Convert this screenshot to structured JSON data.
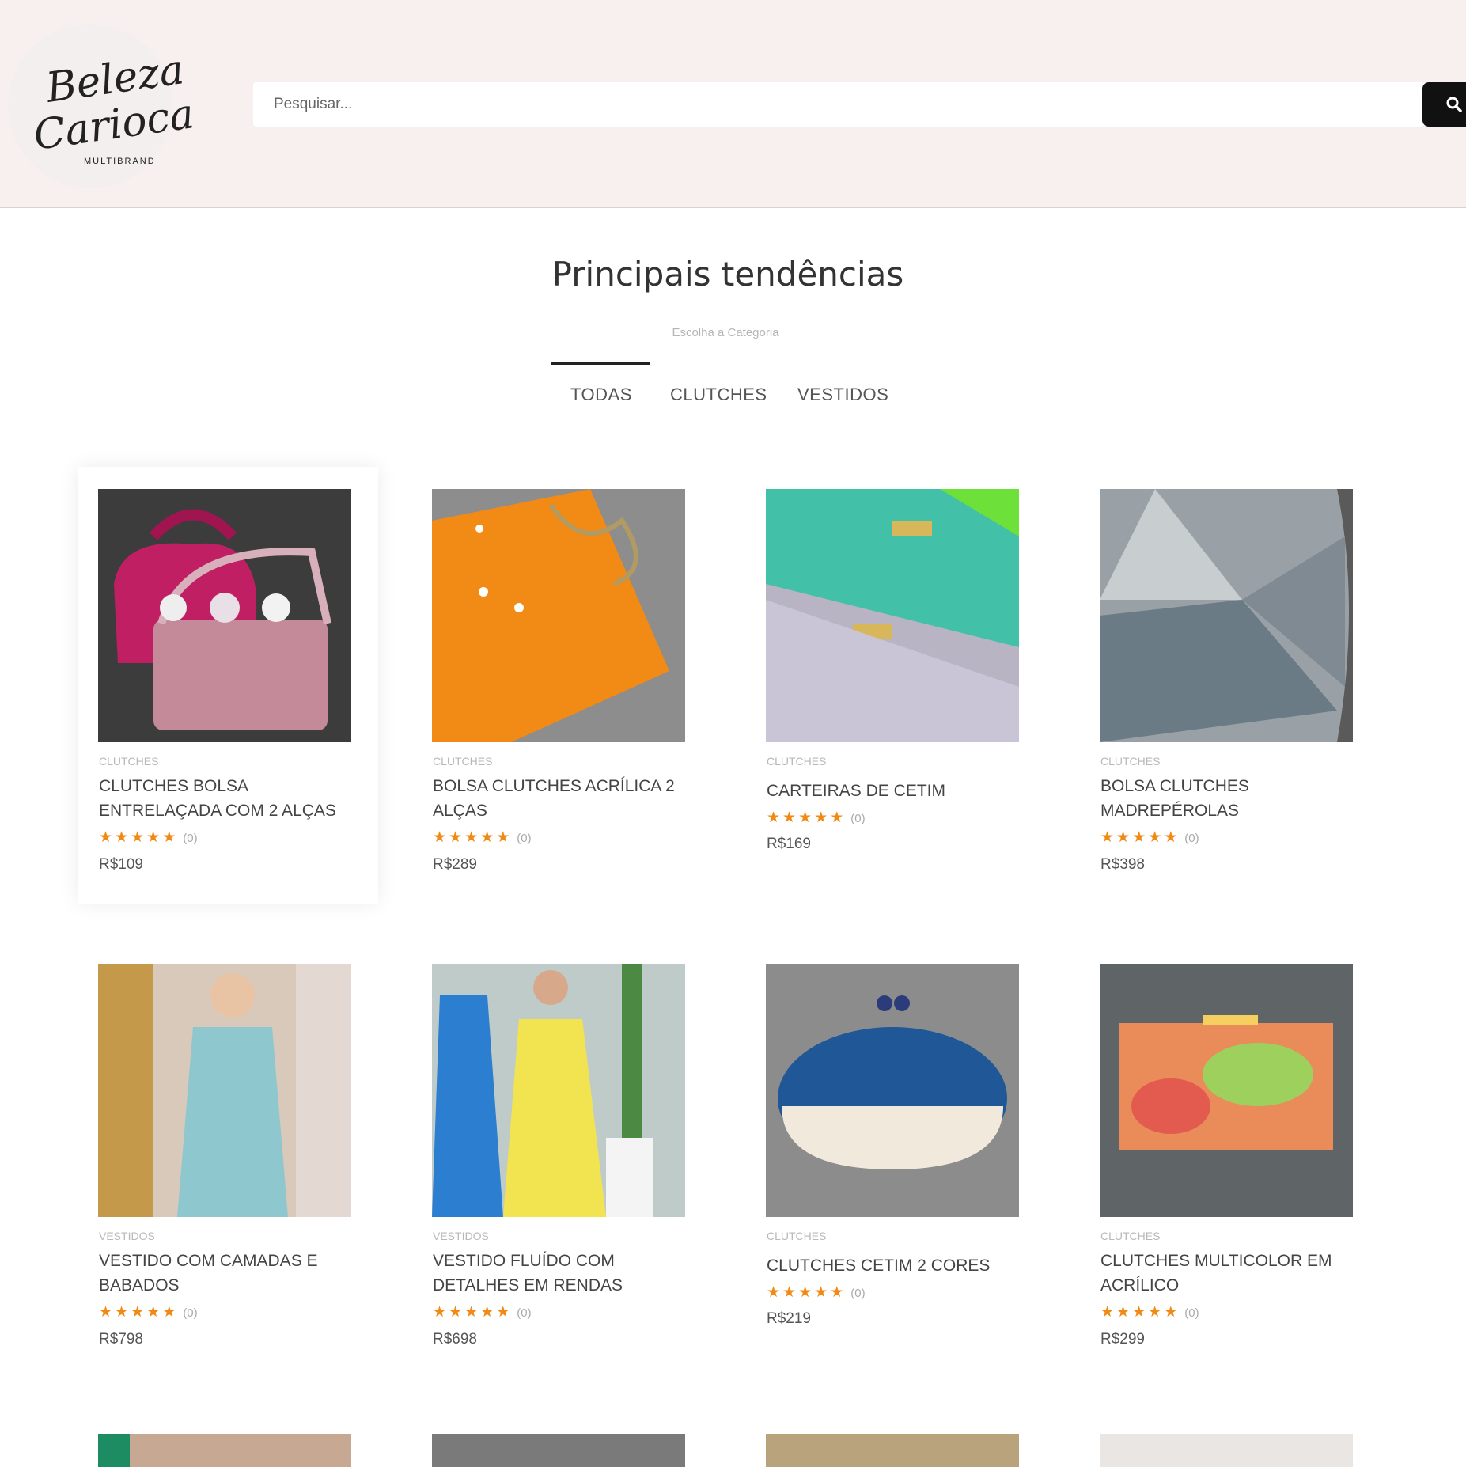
{
  "header": {
    "logo_line1": "Beleza",
    "logo_line2": "Carioca",
    "logo_sub": "MULTIBRAND",
    "search_placeholder": "Pesquisar...",
    "search_icon": "search-icon"
  },
  "section": {
    "title": "Principais tendências",
    "subtitle": "Escolha a Categoria",
    "tabs": [
      "TODAS",
      "CLUTCHES",
      "VESTIDOS"
    ],
    "active_tab": "TODAS"
  },
  "products": [
    {
      "category": "CLUTCHES",
      "title": "CLUTCHES BOLSA ENTRELAÇADA COM 2 ALÇAS",
      "rating_count": "(0)",
      "price": "R$109"
    },
    {
      "category": "CLUTCHES",
      "title": "BOLSA CLUTCHES ACRÍLICA 2 ALÇAS",
      "rating_count": "(0)",
      "price": "R$289"
    },
    {
      "category": "CLUTCHES",
      "title": "CARTEIRAS DE CETIM",
      "rating_count": "(0)",
      "price": "R$169"
    },
    {
      "category": "CLUTCHES",
      "title": "BOLSA CLUTCHES MADREPÉROLAS",
      "rating_count": "(0)",
      "price": "R$398"
    },
    {
      "category": "VESTIDOS",
      "title": "VESTIDO COM CAMADAS E BABADOS",
      "rating_count": "(0)",
      "price": "R$798"
    },
    {
      "category": "VESTIDOS",
      "title": "VESTIDO FLUÍDO COM DETALHES EM RENDAS",
      "rating_count": "(0)",
      "price": "R$698"
    },
    {
      "category": "CLUTCHES",
      "title": "CLUTCHES CETIM 2 CORES",
      "rating_count": "(0)",
      "price": "R$219"
    },
    {
      "category": "CLUTCHES",
      "title": "CLUTCHES MULTICOLOR EM ACRÍLICO",
      "rating_count": "(0)",
      "price": "R$299"
    }
  ],
  "colors": {
    "header_bg": "#f8f0ee",
    "star": "#f08a14",
    "tab_indicator": "#222222"
  }
}
